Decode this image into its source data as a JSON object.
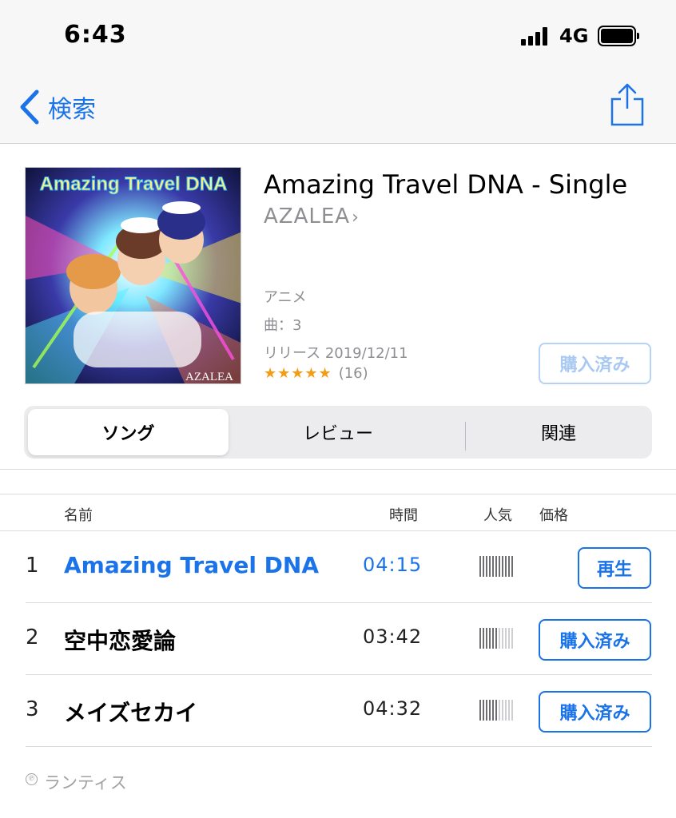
{
  "status_bar": {
    "time": "6:43",
    "network": "4G"
  },
  "nav": {
    "back_label": "検索"
  },
  "album": {
    "artwork_text": "Amazing Travel DNA",
    "artwork_artist": "AZALEA",
    "title": "Amazing Travel DNA - Single",
    "artist": "AZALEA",
    "genre": "アニメ",
    "track_count": "曲：3",
    "release": "リリース 2019/12/11",
    "stars": "★★★★★",
    "rating_count": "(16)",
    "purchase_label": "購入済み"
  },
  "tabs": [
    {
      "label": "ソング",
      "active": true
    },
    {
      "label": "レビュー",
      "active": false
    },
    {
      "label": "関連",
      "active": false
    }
  ],
  "table": {
    "headers": {
      "name": "名前",
      "time": "時間",
      "popularity": "人気",
      "price": "価格"
    },
    "rows": [
      {
        "number": "1",
        "name": "Amazing Travel DNA",
        "time": "04:15",
        "popularity": 1.0,
        "action": "再生",
        "playing": true
      },
      {
        "number": "2",
        "name": "空中恋愛論",
        "time": "03:42",
        "popularity": 0.5,
        "action": "購入済み",
        "playing": false
      },
      {
        "number": "3",
        "name": "メイズセカイ",
        "time": "04:32",
        "popularity": 0.5,
        "action": "購入済み",
        "playing": false
      }
    ]
  },
  "footer": {
    "copyright_symbol": "℗",
    "copyright": "ランティス"
  },
  "colors": {
    "accent": "#1a73e8",
    "secondary_text": "#8e8e93",
    "star": "#f59b14"
  }
}
